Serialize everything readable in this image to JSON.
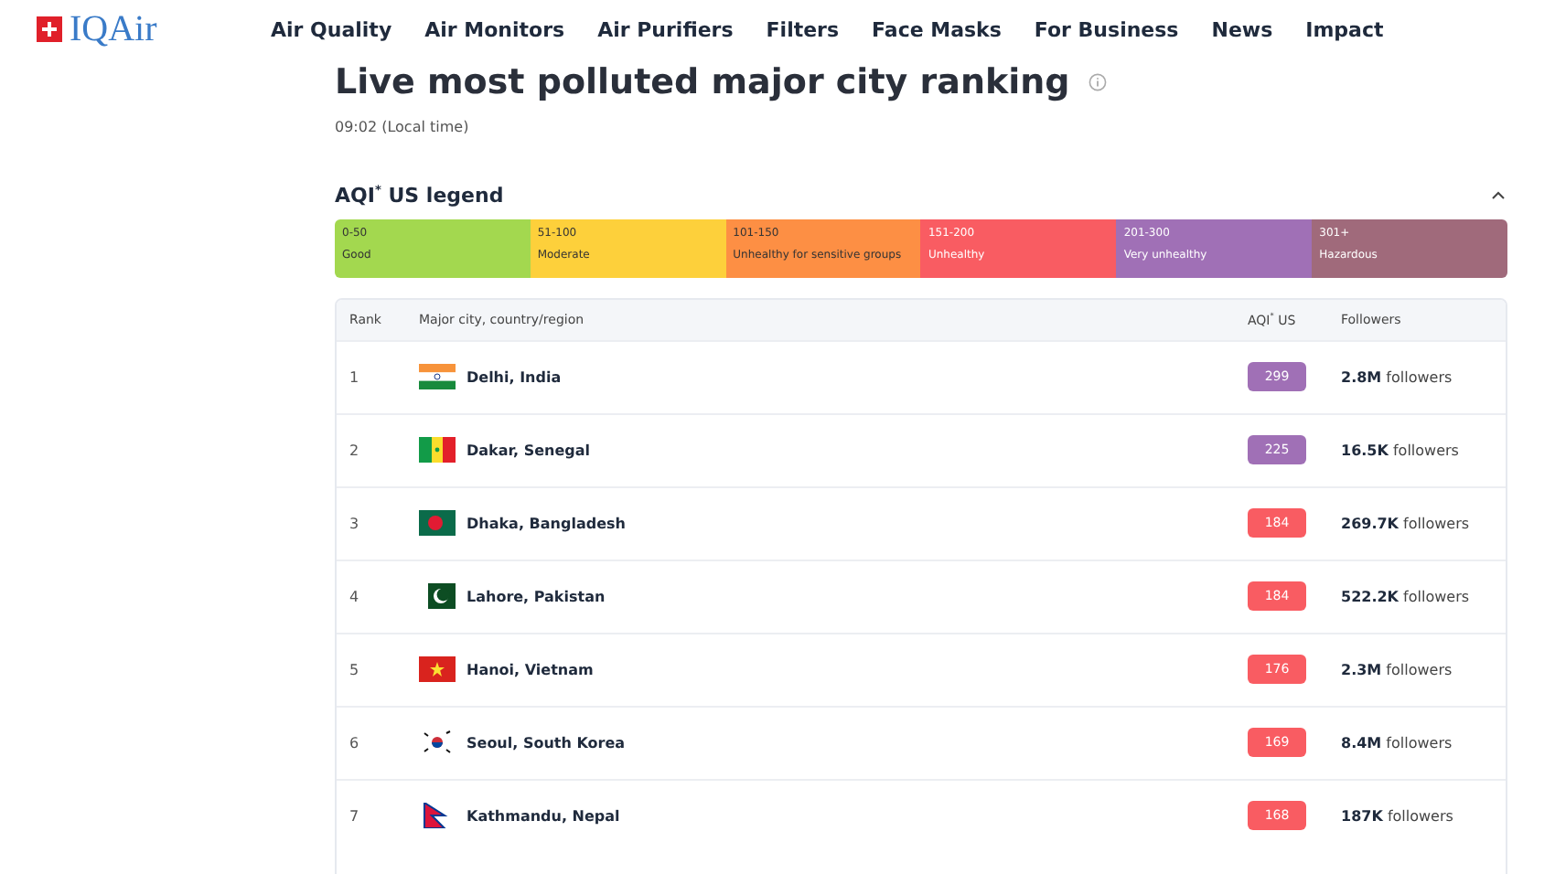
{
  "header": {
    "logo": "IQAir",
    "nav": [
      "Air Quality",
      "Air Monitors",
      "Air Purifiers",
      "Filters",
      "Face Masks",
      "For Business",
      "News",
      "Impact"
    ]
  },
  "title": "Live most polluted major city ranking",
  "time": "09:02 (Local time)",
  "legend": {
    "title": "AQI$^{*}$ US legend",
    "expanded": true,
    "items": [
      {
        "range": "0-50",
        "label": "Good",
        "color": "#a3d84f"
      },
      {
        "range": "51-100",
        "label": "Moderate",
        "color": "#fdd03b"
      },
      {
        "range": "101-150",
        "label": "Unhealthy for sensitive groups",
        "color": "#fd8f44"
      },
      {
        "range": "151-200",
        "label": "Unhealthy",
        "color": "#f95c62"
      },
      {
        "range": "201-300",
        "label": "Very unhealthy",
        "color": "#a070b6"
      },
      {
        "range": "301+",
        "label": "Hazardous",
        "color": "#a06a7b"
      }
    ]
  },
  "table": {
    "columns": [
      "Rank",
      "Major city, country/region",
      "AQI$^{*}$ US",
      "Followers"
    ],
    "rows": [
      {
        "rank": "1",
        "kind": "india",
        "city": "Delhi, India",
        "aqi": "299",
        "color": "#a070b6",
        "followers": "**2.8M** followers"
      },
      {
        "rank": "2",
        "kind": "senegal",
        "city": "Dakar, Senegal",
        "aqi": "225",
        "color": "#a070b6",
        "followers": "**16.5K** followers"
      },
      {
        "rank": "3",
        "kind": "bangladesh",
        "city": "Dhaka, Bangladesh",
        "aqi": "184",
        "color": "#f95c62",
        "followers": "**269.7K** followers"
      },
      {
        "rank": "4",
        "kind": "pakistan",
        "city": "Lahore, Pakistan",
        "aqi": "184",
        "color": "#f95c62",
        "followers": "**522.2K** followers"
      },
      {
        "rank": "5",
        "kind": "vietnam",
        "city": "Hanoi, Vietnam",
        "aqi": "176",
        "color": "#f95c62",
        "followers": "**2.3M** followers"
      },
      {
        "rank": "6",
        "kind": "south-korea",
        "city": "Seoul, South Korea",
        "aqi": "169",
        "color": "#f95c62",
        "followers": "**8.4M** followers"
      },
      {
        "rank": "7",
        "kind": "nepal",
        "city": "Kathmandu, Nepal",
        "aqi": "168",
        "color": "#f95c62",
        "followers": "**187K** followers"
      }
    ]
  }
}
